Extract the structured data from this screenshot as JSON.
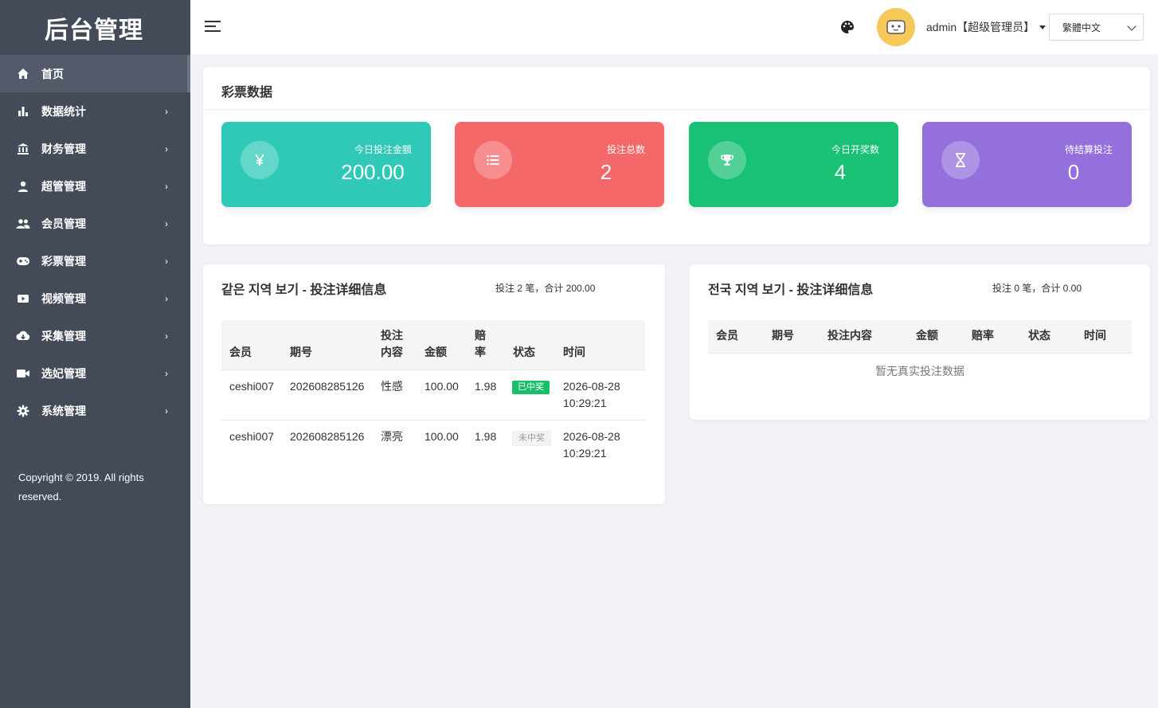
{
  "sidebar": {
    "brand": "后台管理",
    "items": [
      {
        "label": "首页",
        "icon": "home-icon"
      },
      {
        "label": "数据统计",
        "icon": "bar-chart-icon"
      },
      {
        "label": "财务管理",
        "icon": "bank-icon"
      },
      {
        "label": "超管管理",
        "icon": "user-icon"
      },
      {
        "label": "会员管理",
        "icon": "users-icon"
      },
      {
        "label": "彩票管理",
        "icon": "gamepad-icon"
      },
      {
        "label": "视频管理",
        "icon": "video-icon"
      },
      {
        "label": "采集管理",
        "icon": "cloud-download-icon"
      },
      {
        "label": "选妃管理",
        "icon": "camera-icon"
      },
      {
        "label": "系统管理",
        "icon": "gear-icon"
      }
    ],
    "arrow": "›",
    "copyright": "Copyright © 2019. All rights reserved."
  },
  "header": {
    "user": "admin【超级管理员】",
    "language": "繁體中文",
    "colors": {
      "avatar_bg": "#f6c85a"
    }
  },
  "stats": {
    "title": "彩票数据",
    "cards": [
      {
        "label": "今日投注金额",
        "value": "200.00",
        "color": "#30c9b8",
        "icon": "yen-icon"
      },
      {
        "label": "投注总数",
        "value": "2",
        "color": "#f5686a",
        "icon": "list-icon"
      },
      {
        "label": "今日开奖数",
        "value": "4",
        "color": "#18c173",
        "icon": "trophy-icon"
      },
      {
        "label": "待结算投注",
        "value": "0",
        "color": "#9370db",
        "icon": "hourglass-icon"
      }
    ]
  },
  "local_table": {
    "title": "같은 지역 보기 - 投注详细信息",
    "summary": "投注 2 笔，合计 200.00",
    "headers": [
      "会员",
      "期号",
      "投注内容",
      "金额",
      "赔率",
      "状态",
      "时间"
    ],
    "rows": [
      {
        "member": "ceshi007",
        "period": "202608285126",
        "content": "性感",
        "amount": "100.00",
        "odds": "1.98",
        "status": "已中奖",
        "date": "2026-08-28",
        "time": "10:29:21"
      },
      {
        "member": "ceshi007",
        "period": "202608285126",
        "content": "漂亮",
        "amount": "100.00",
        "odds": "1.98",
        "status": "未中奖",
        "date": "2026-08-28",
        "time": "10:29:21"
      }
    ]
  },
  "national_table": {
    "title": "전국 지역 보기 - 投注详细信息",
    "summary": "投注 0 笔，合计 0.00",
    "headers": [
      "会员",
      "期号",
      "投注内容",
      "金额",
      "赔率",
      "状态",
      "时间"
    ],
    "empty": "暂无真实投注数据"
  }
}
